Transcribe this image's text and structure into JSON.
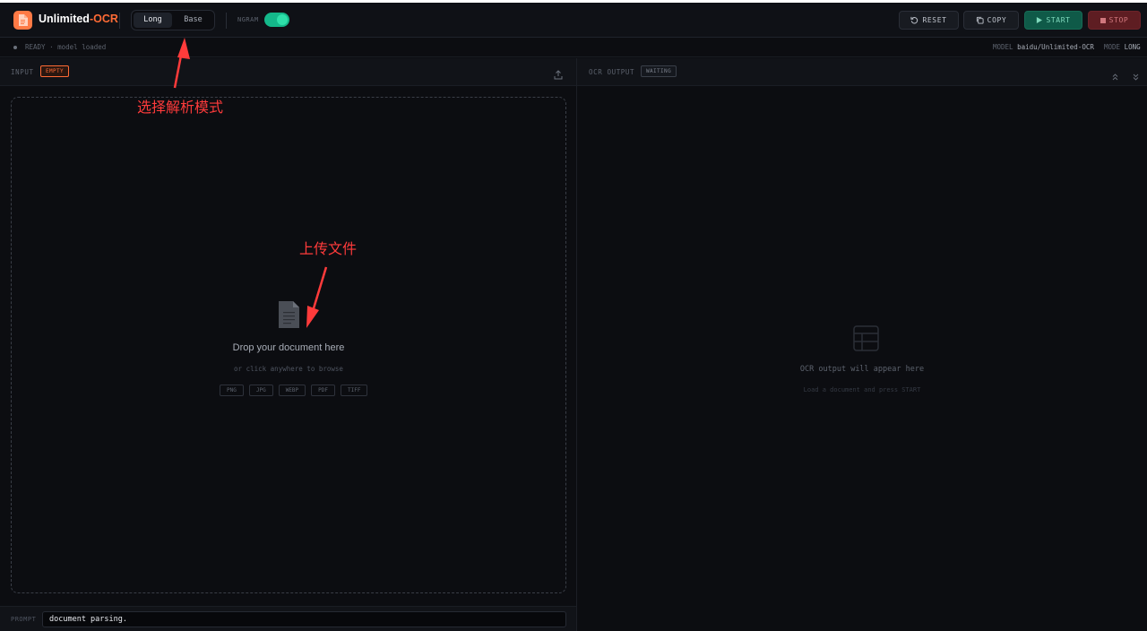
{
  "app": {
    "brand_main": "Unlimited",
    "brand_sep": "-",
    "brand_accent": "OCR",
    "accent_color": "#ff6b35",
    "logo_icon": "document-icon"
  },
  "header": {
    "modes": [
      "Long",
      "Base"
    ],
    "active_mode": "Long",
    "ngram_label": "NGRAM",
    "ngram_enabled": true,
    "reset_label": "RESET",
    "copy_label": "COPY",
    "start_label": "START",
    "stop_label": "STOP",
    "start_color": "#0f5a48",
    "stop_color": "#5e1d22"
  },
  "status": {
    "text": "READY · model loaded",
    "model_key": "MODEL",
    "model_value": "baidu/Unlimited-OCR",
    "mode_key": "MODE",
    "mode_value": "LONG"
  },
  "input_panel": {
    "title": "INPUT",
    "badge": "EMPTY",
    "upload_icon": "upload-icon",
    "drop_title": "Drop your document here",
    "drop_sub": "or click anywhere to browse",
    "formats": [
      "PNG",
      "JPG",
      "WEBP",
      "PDF",
      "TIFF"
    ]
  },
  "prompt": {
    "label": "PROMPT",
    "value": "document parsing."
  },
  "output_panel": {
    "title": "OCR OUTPUT",
    "badge": "WAITING",
    "empty_title": "OCR output will appear here",
    "empty_sub": "Load a document and press START"
  },
  "annotations": {
    "mode_hint": "选择解析模式",
    "upload_hint": "上传文件",
    "color": "#ff3b3b"
  }
}
